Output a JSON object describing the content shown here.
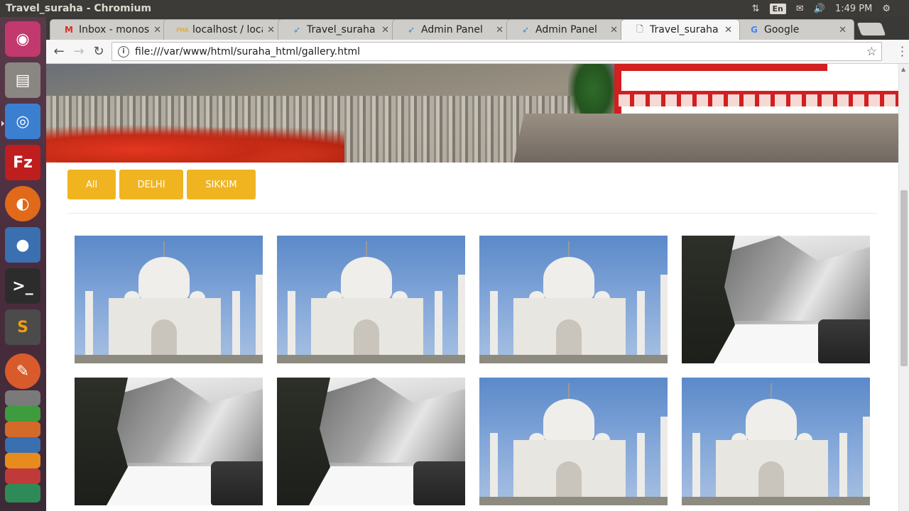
{
  "system": {
    "window_title": "Travel_suraha - Chromium",
    "keyboard": "En",
    "clock": "1:49 PM"
  },
  "tabs": [
    {
      "label": "Inbox - monoshr",
      "icon": "gmail-icon"
    },
    {
      "label": "localhost / local",
      "icon": "phpmyadmin-icon"
    },
    {
      "label": "Travel_suraha",
      "icon": "bird-icon"
    },
    {
      "label": "Admin Panel",
      "icon": "bird-icon"
    },
    {
      "label": "Admin Panel",
      "icon": "bird-icon"
    },
    {
      "label": "Travel_suraha",
      "icon": "page-icon",
      "active": true
    },
    {
      "label": "Google",
      "icon": "google-icon"
    }
  ],
  "toolbar": {
    "url": "file:///var/www/html/suraha_html/gallery.html"
  },
  "filters": [
    "All",
    "DELHI",
    "SIKKIM"
  ],
  "gallery": [
    {
      "kind": "taj"
    },
    {
      "kind": "taj"
    },
    {
      "kind": "taj"
    },
    {
      "kind": "snow"
    },
    {
      "kind": "snow"
    },
    {
      "kind": "snow"
    },
    {
      "kind": "taj"
    },
    {
      "kind": "taj"
    }
  ],
  "colors": {
    "filter_bg": "#f0b421",
    "launcher": "#4a2d3d"
  }
}
